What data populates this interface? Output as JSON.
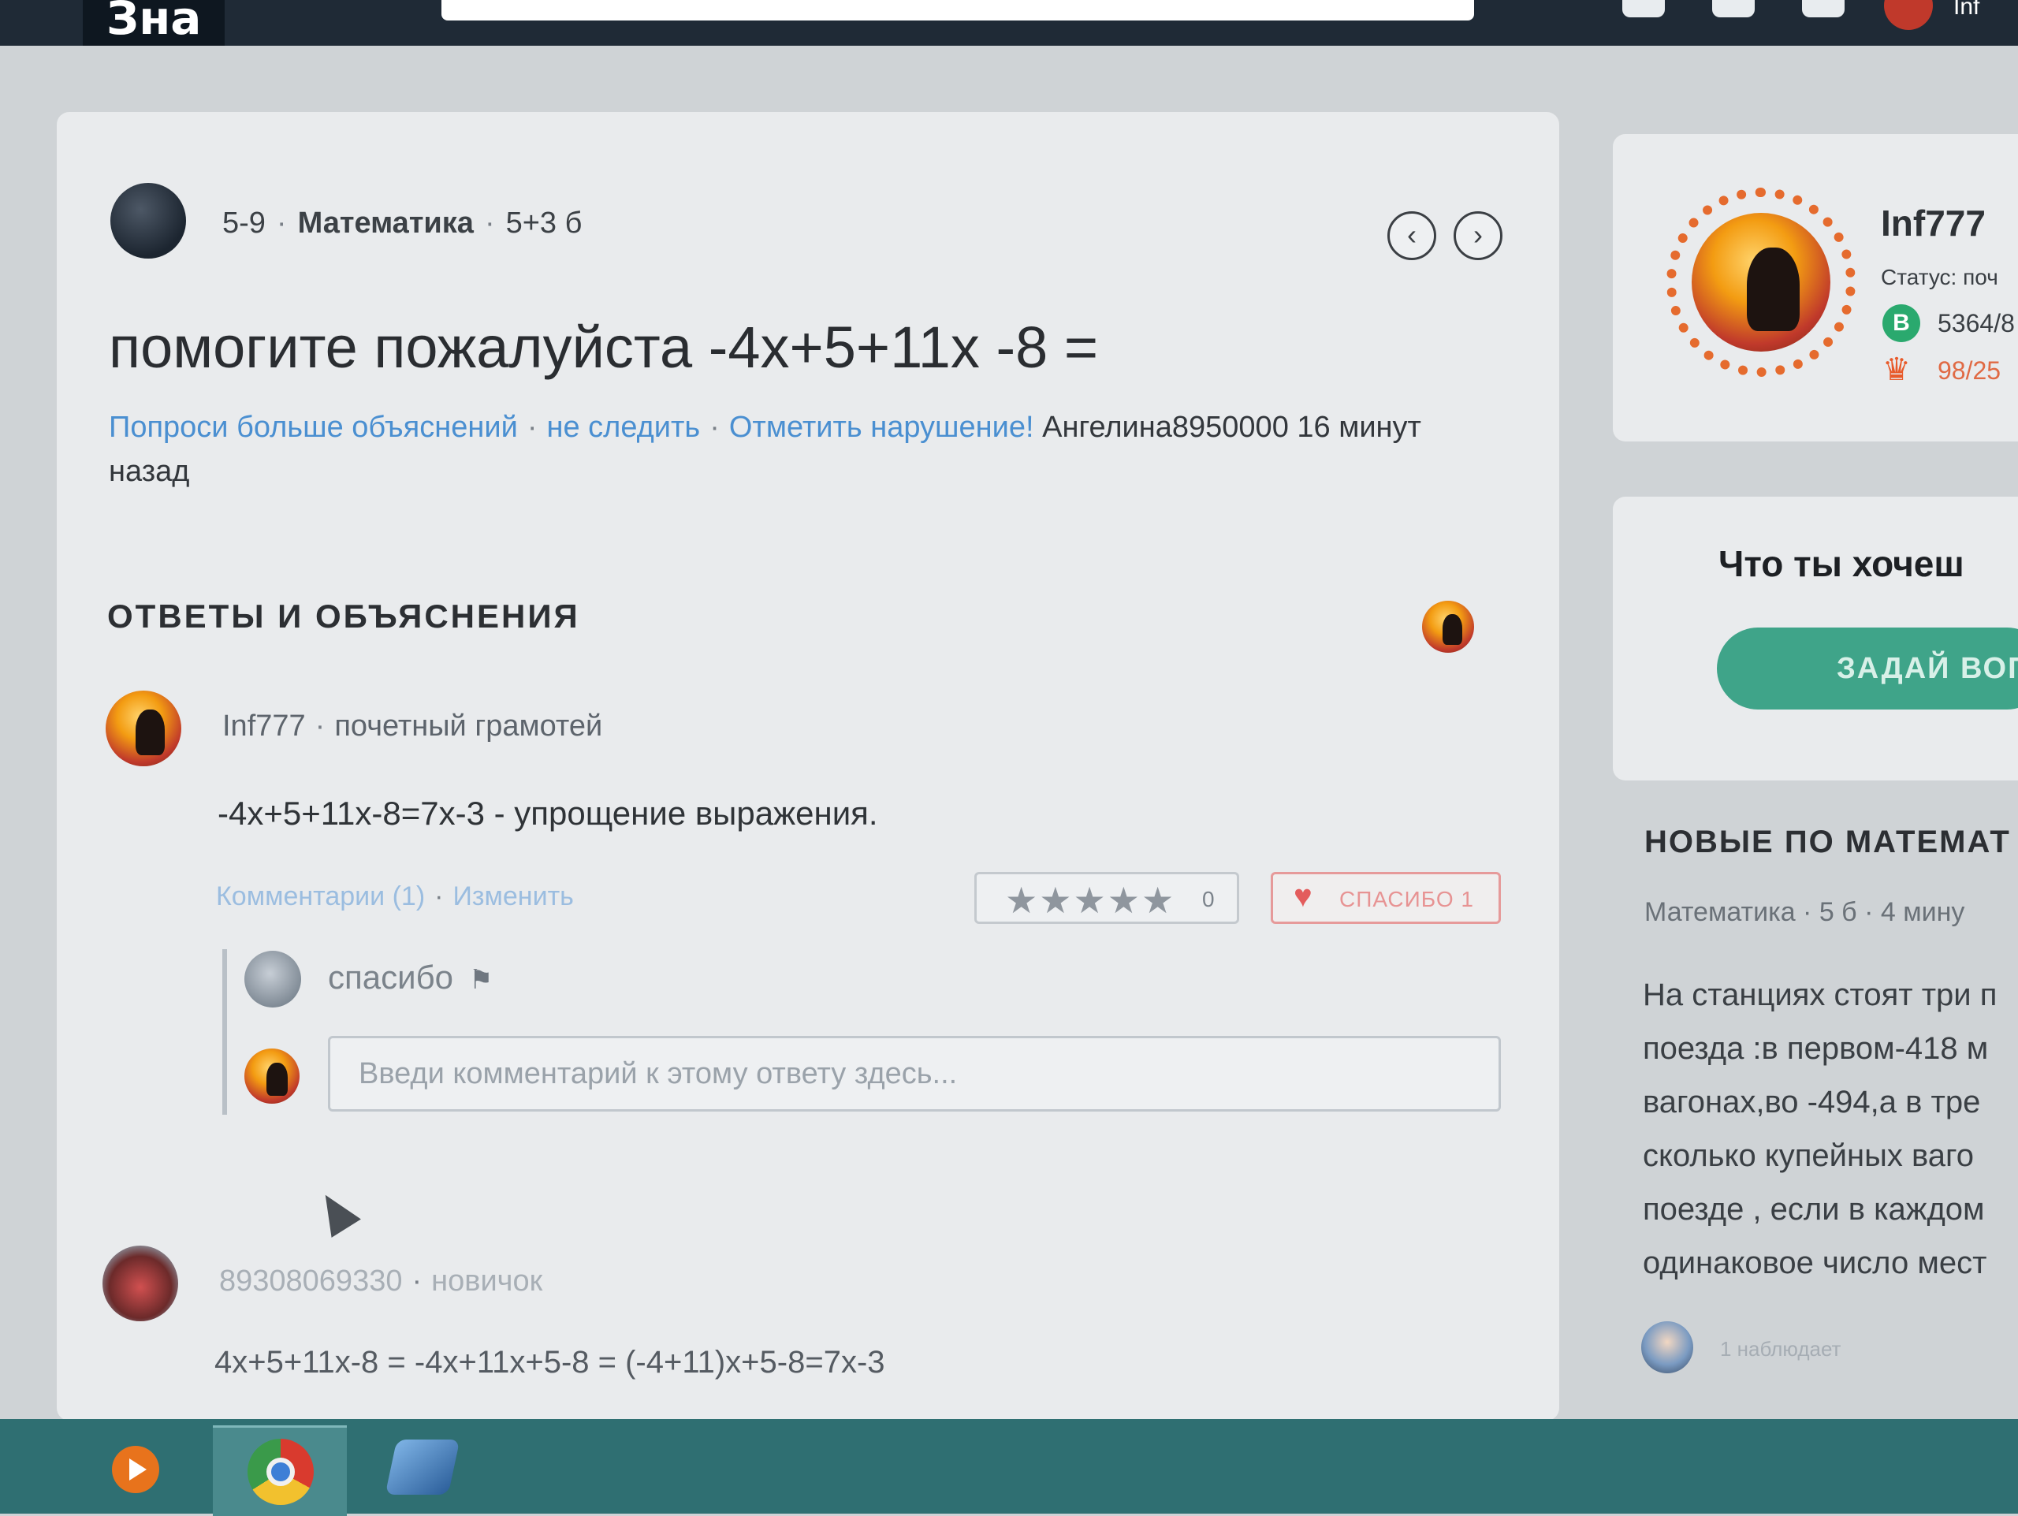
{
  "header": {
    "logo_text": "Зна",
    "user_label": "Inf"
  },
  "question": {
    "grade": "5-9",
    "subject": "Математика",
    "points": "5+3 б",
    "title": "помогите пожалуйста -4х+5+11х -8 =",
    "actions": {
      "ask_more": "Попроси больше объяснений",
      "unfollow": "не следить",
      "report": "Отметить нарушение!"
    },
    "author_time": "Ангелина8950000 16 минут назад",
    "prev_icon": "chevron-left-icon",
    "next_icon": "chevron-right-icon"
  },
  "answers_section": {
    "title": "ОТВЕТЫ И ОБЪЯСНЕНИЯ"
  },
  "answer1": {
    "user": "Inf777",
    "rank": "почетный грамотей",
    "text": "-4х+5+11х-8=7х-3 - упрощение выражения.",
    "comments_link": "Комментарии (1)",
    "edit_link": "Изменить",
    "stars": "★★★★★",
    "rating_count": "0",
    "thanks_label": "СПАСИБО 1",
    "comment": {
      "text": "спасибо",
      "input_placeholder": "Введи комментарий к этому ответу здесь..."
    }
  },
  "answer2": {
    "user": "89308069330",
    "rank": "новичок",
    "text": "4х+5+11х-8 = -4х+11х+5-8 = (-4+11)х+5-8=7х-3"
  },
  "profile": {
    "name": "Inf777",
    "status": "Статус: поч",
    "points_badge": "B",
    "points": "5364/8",
    "crown_value": "98/25"
  },
  "ask": {
    "title": "Что ты хочеш",
    "button": "ЗАДАЙ ВОП"
  },
  "new_questions": {
    "title": "НОВЫЕ ПО МАТЕМАТ",
    "meta": "Математика · 5 б · 4 мину",
    "lines": [
      "На станциях стоят три п",
      "поезда :в первом-418 м",
      "вагонах,во -494,а в тре",
      "сколько купейных ваго",
      "поезде , если в каждом",
      "одинаковое число мест"
    ],
    "watchers": "1 наблюдает"
  },
  "colors": {
    "link": "#4a8fd1",
    "accent_green": "#3fa489",
    "thanks_red": "#e35c5c",
    "taskbar": "#2f6f72"
  }
}
